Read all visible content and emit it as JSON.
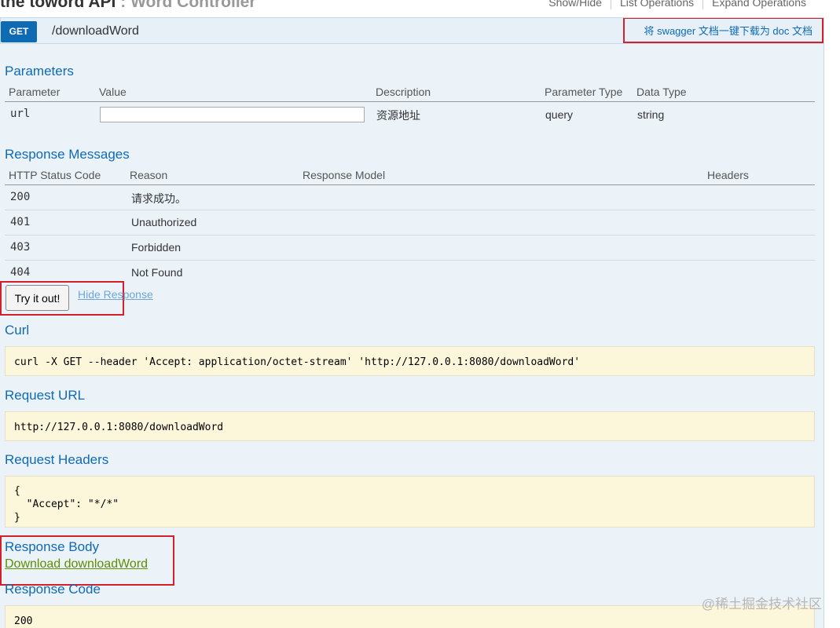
{
  "header": {
    "api_name": "the toword API",
    "separator": " : ",
    "controller_name": "Word Controller",
    "links": [
      "Show/Hide",
      "List Operations",
      "Expand Operations"
    ]
  },
  "operation": {
    "method": "GET",
    "path": "/downloadWord",
    "summary_link": "将 swagger 文档一键下载为 doc 文档"
  },
  "parameters": {
    "title": "Parameters",
    "headers": [
      "Parameter",
      "Value",
      "Description",
      "Parameter Type",
      "Data Type"
    ],
    "rows": [
      {
        "name": "url",
        "value": "",
        "description": "资源地址",
        "type": "query",
        "data_type": "string"
      }
    ]
  },
  "responses": {
    "title": "Response Messages",
    "headers": [
      "HTTP Status Code",
      "Reason",
      "Response Model",
      "Headers"
    ],
    "rows": [
      {
        "code": "200",
        "reason": "请求成功。"
      },
      {
        "code": "401",
        "reason": "Unauthorized"
      },
      {
        "code": "403",
        "reason": "Forbidden"
      },
      {
        "code": "404",
        "reason": "Not Found"
      }
    ]
  },
  "actions": {
    "try_label": "Try it out!",
    "hide_label": "Hide Response"
  },
  "curl": {
    "title": "Curl",
    "command": "curl -X GET --header 'Accept: application/octet-stream' 'http://127.0.0.1:8080/downloadWord'"
  },
  "request_url": {
    "title": "Request URL",
    "value": "http://127.0.0.1:8080/downloadWord"
  },
  "request_headers": {
    "title": "Request Headers",
    "value": "{\n  \"Accept\": \"*/*\"\n}"
  },
  "response_body": {
    "title": "Response Body",
    "link": "Download downloadWord"
  },
  "response_code": {
    "title": "Response Code",
    "value": "200"
  },
  "watermark": "@稀土掘金技术社区",
  "colors": {
    "get_badge": "#0f6ab4",
    "section_title": "#0f6ab4",
    "highlight_frame": "#d2202c",
    "code_bg": "#fcf6db",
    "download_link": "#5d8f00"
  }
}
